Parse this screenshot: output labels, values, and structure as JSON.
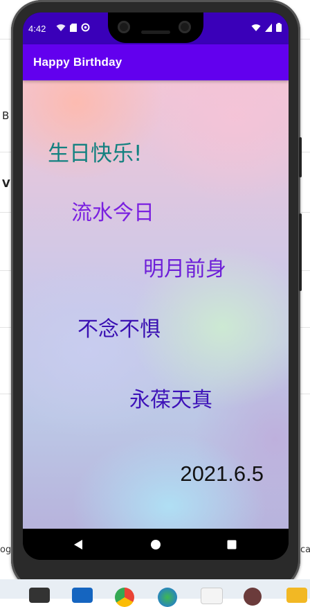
{
  "background": {
    "left_letter_1": "B",
    "left_letter_2": "V",
    "bottom_left_text": "og",
    "bottom_right_text": "ca"
  },
  "status_bar": {
    "time": "4:42",
    "color": "#3a00b9"
  },
  "app_bar": {
    "title": "Happy Birthday",
    "color": "#6200ee"
  },
  "content": {
    "lines": [
      "生日快乐!",
      "流水今日",
      "明月前身",
      "不念不惧",
      "永葆天真"
    ],
    "date": "2021.6.5"
  },
  "nav_bar": {
    "back_icon": "triangle-back-icon",
    "home_icon": "circle-home-icon",
    "recents_icon": "square-recents-icon"
  },
  "taskbar": {
    "icons": [
      "briefcase-icon",
      "mail-icon",
      "chrome-icon",
      "globe-icon",
      "text-app-icon",
      "avatar-icon",
      "folder-icon"
    ]
  }
}
